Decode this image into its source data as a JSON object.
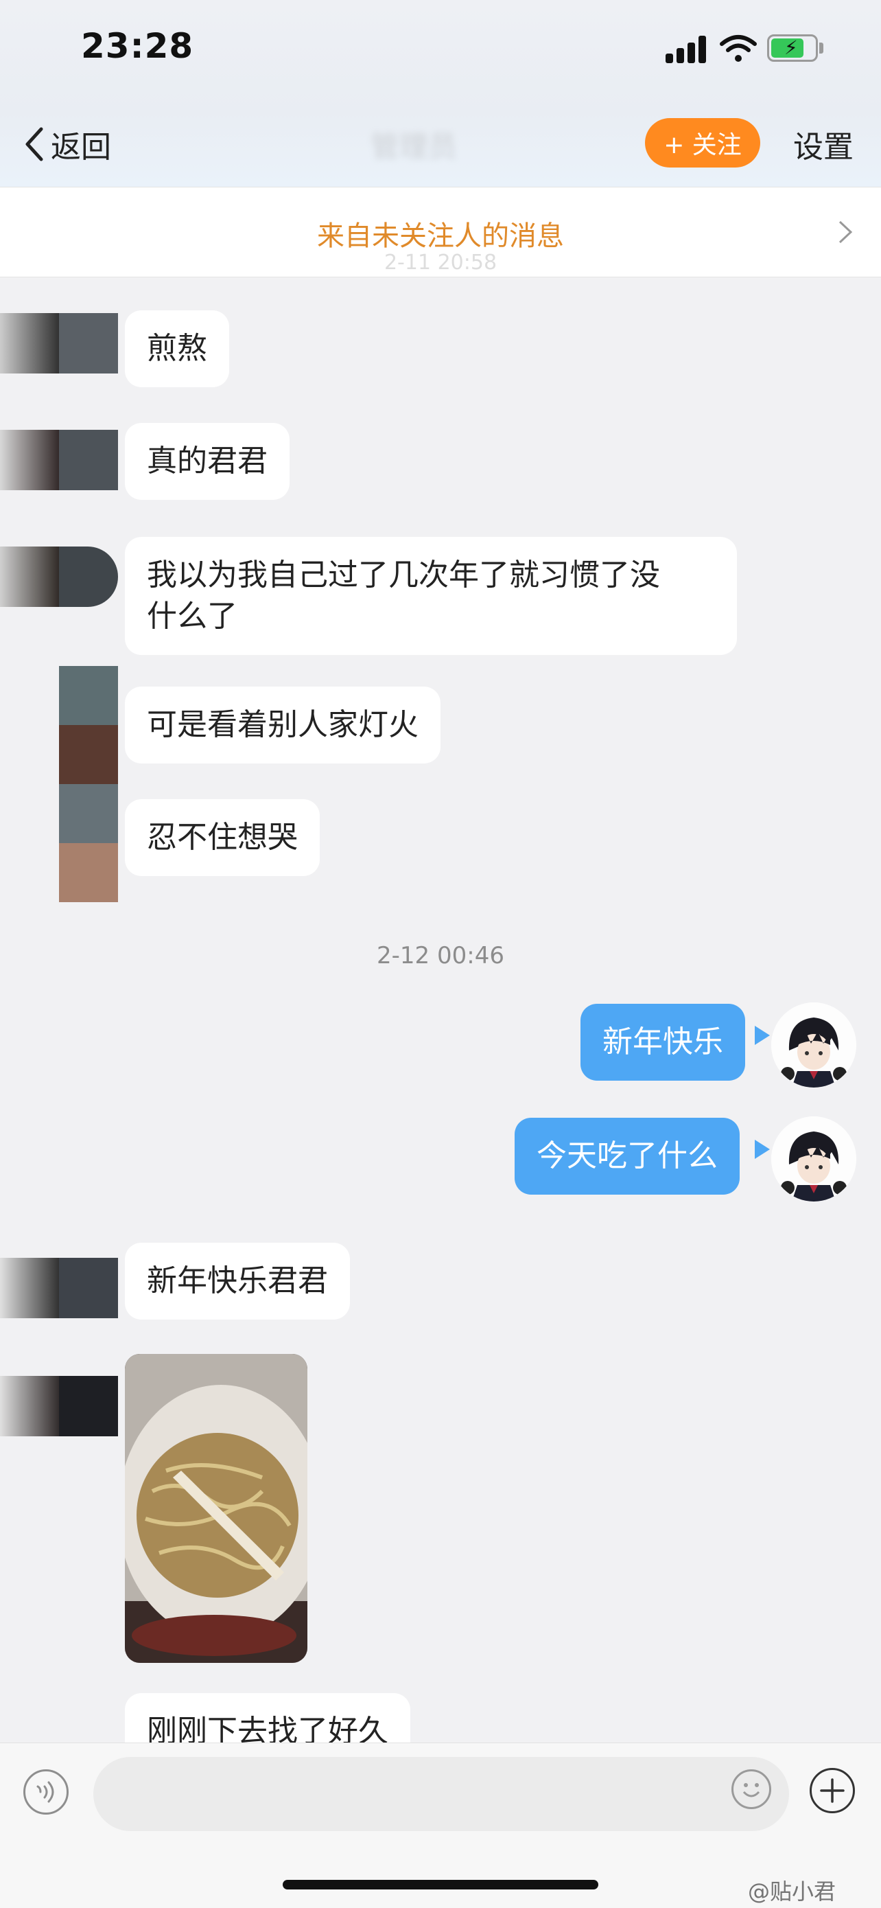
{
  "status_bar": {
    "time": "23:28"
  },
  "nav": {
    "back_label": "返回",
    "title": "管理员",
    "follow_label": "+ 关注",
    "settings_label": "设置"
  },
  "banner": {
    "text": "来自未关注人的消息",
    "time": "2-11 20:58"
  },
  "messages": [
    {
      "text": "煎熬"
    },
    {
      "text": "真的君君"
    },
    {
      "line1": "我以为我自己过了几次年了就习惯了没",
      "line2": "什么了"
    },
    {
      "text": "可是看着别人家灯火"
    },
    {
      "text": "忍不住想哭"
    },
    {
      "timestamp": "2-12 00:46"
    },
    {
      "text": "新年快乐",
      "outgoing": true
    },
    {
      "text": "今天吃了什么",
      "outgoing": true
    },
    {
      "text": "新年快乐君君"
    },
    {
      "image": "instant-noodles-photo"
    },
    {
      "text": "刚刚下去找了好久"
    }
  ],
  "icons": {
    "back": "chevron-left-icon",
    "voice": "voice-icon",
    "emoji": "emoji-icon",
    "plus": "plus-icon"
  },
  "colors": {
    "accent": "#ff8a1f",
    "outgoing_bubble": "#4ea7f4",
    "banner_text": "#e08a2a"
  },
  "watermark": "@贴小君"
}
